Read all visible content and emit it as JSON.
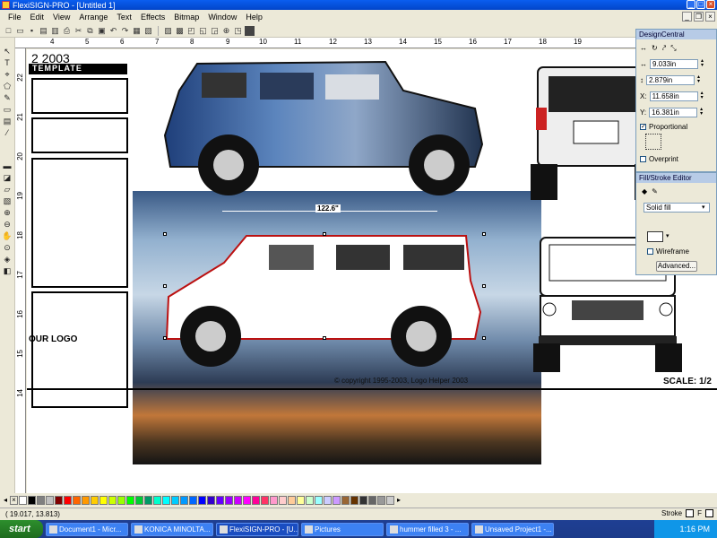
{
  "window": {
    "title": "FlexiSIGN-PRO - [Untitled 1]"
  },
  "menu": [
    "File",
    "Edit",
    "View",
    "Arrange",
    "Text",
    "Effects",
    "Bitmap",
    "Window",
    "Help"
  ],
  "ruler": {
    "top": [
      "4",
      "5",
      "6",
      "7",
      "8",
      "9",
      "10",
      "11",
      "12",
      "13",
      "14",
      "15",
      "16",
      "17",
      "18",
      "19"
    ],
    "left": [
      "22",
      "21",
      "20",
      "19",
      "18",
      "17",
      "16",
      "15",
      "14"
    ]
  },
  "template": {
    "title": "2 2003",
    "band": "TEMPLATE",
    "logo_text": "OUR LOGO",
    "copyright": "© copyright 1995-2003, Logo Helper 2003",
    "scale": "SCALE: 1/2",
    "dimension": "122.6\""
  },
  "design_central": {
    "title": "DesignCentral",
    "width": "9.033in",
    "height": "2.879in",
    "x_label": "X:",
    "x": "11.658in",
    "y_label": "Y:",
    "y": "16.381in",
    "proportional": "Proportional",
    "overprint": "Overprint"
  },
  "fill_stroke": {
    "title": "Fill/Stroke Editor",
    "fill_type": "Solid fill",
    "wireframe": "Wireframe",
    "advanced": "Advanced..."
  },
  "palette": [
    "#ffffff",
    "#000000",
    "#808080",
    "#c0c0c0",
    "#800000",
    "#ff0000",
    "#ff6600",
    "#ff9900",
    "#ffcc00",
    "#ffff00",
    "#ccff00",
    "#99ff00",
    "#00ff00",
    "#00cc33",
    "#009966",
    "#00ffcc",
    "#00ffff",
    "#00ccff",
    "#0099ff",
    "#0066ff",
    "#0000ff",
    "#3300cc",
    "#6600ff",
    "#9900ff",
    "#cc00ff",
    "#ff00ff",
    "#ff0099",
    "#ff3366",
    "#ff99cc",
    "#ffcccc",
    "#ffcc99",
    "#ffff99",
    "#ccffcc",
    "#99ffff",
    "#ccccff",
    "#cc99ff",
    "#996633",
    "#663300",
    "#333333",
    "#666666",
    "#999999",
    "#cccccc"
  ],
  "status": {
    "coords": "( 19.017,    13.813)",
    "stroke_label": "Stroke"
  },
  "taskbar": {
    "start": "start",
    "tasks": [
      "Document1 - Micr...",
      "KONICA MINOLTA...",
      "FlexiSIGN-PRO - [U...",
      "Pictures",
      "hummer filled 3 - ...",
      "Unsaved Project1 -..."
    ],
    "clock": "1:16 PM"
  }
}
